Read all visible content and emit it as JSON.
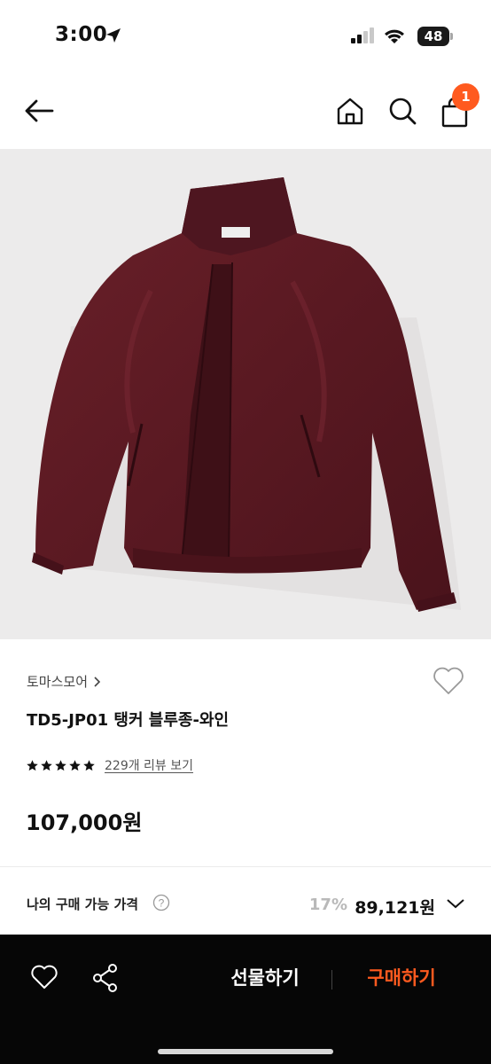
{
  "status_bar": {
    "time": "3:00",
    "battery": "48"
  },
  "nav": {
    "cart_count": "1"
  },
  "colors": {
    "accent": "#ff5a1f",
    "jacket": "#5c1a24",
    "image_bg": "#ecebeb"
  },
  "product": {
    "brand": "토마스모어",
    "title": "TD5-JP01 탱커 블루종-와인",
    "rating_stars": 5,
    "review_link": "229개 리뷰 보기",
    "price": "107,000원"
  },
  "my_price": {
    "label": "나의 구매 가능 가격",
    "discount": "17%",
    "price": "89,121원"
  },
  "bottom_bar": {
    "gift_label": "선물하기",
    "buy_label": "구매하기"
  }
}
